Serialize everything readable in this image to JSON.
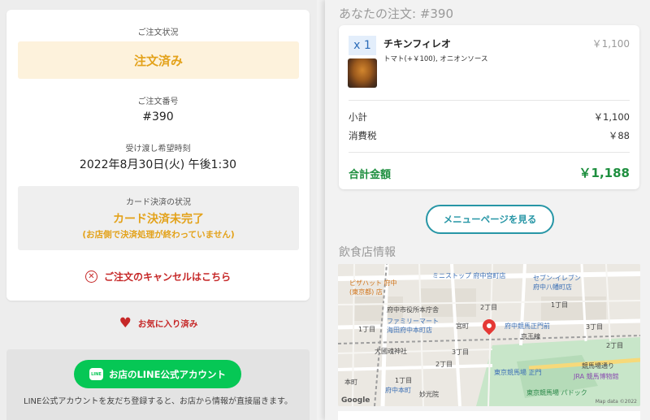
{
  "status_card": {
    "order_status_label": "ご注文状況",
    "order_status_value": "注文済み",
    "order_number_label": "ご注文番号",
    "order_number_value": "#390",
    "pickup_label": "受け渡し希望時刻",
    "pickup_value": "2022年8月30日(火) 午後1:30",
    "payment_label": "カード決済の状況",
    "payment_status": "カード決済未完了",
    "payment_note": "(お店側で決済処理が終わっていません)",
    "cancel_link": "ご注文のキャンセルはこちら"
  },
  "favorite": {
    "label": "お気に入り済み"
  },
  "line_card": {
    "button_label": "お店のLINE公式アカウント",
    "logo_text": "LINE",
    "note": "LINE公式アカウントを友だち登録すると、お店から情報が直接届きます。"
  },
  "order": {
    "title": "あなたの注文: #390",
    "item": {
      "quantity": "x 1",
      "name": "チキンフィレオ",
      "options": "トマト(+￥100), オニオンソース",
      "price": "￥1,100"
    },
    "subtotal_label": "小計",
    "subtotal_value": "￥1,100",
    "tax_label": "消費税",
    "tax_value": "￥88",
    "total_label": "合計金額",
    "total_value": "￥1,188"
  },
  "menu_button": "メニューページを見る",
  "restaurant_title": "飲食店情報",
  "map": {
    "labels": {
      "pizza": "ピザハット 府中\n(東京都) 店",
      "ministop": "ミニストップ 府中宮町店",
      "seven": "セブン-イレブン\n府中八幡町店",
      "cityhall": "府中市役所本庁舎",
      "familymart": "ファミリーマート\n海田府中本町店",
      "miyamachi": "宮町",
      "keiodori": "府中競馬正門前",
      "keioline": "京王線",
      "kunitama": "大國魂神社",
      "honmachi": "本町",
      "honmachi_st": "府中本町",
      "myokoin": "妙光院",
      "seimon": "東京競馬場 正門",
      "park": "東京競馬場 パドック",
      "jra": "JRA 競馬博物館",
      "keibajo_dori": "競馬場通り",
      "ch1": "1丁目",
      "ch2": "2丁目",
      "ch3": "3丁目",
      "ch2b": "2丁目",
      "ch1b": "1丁目",
      "ch3b": "3丁目",
      "ch1c": "1丁目",
      "ch2c": "2丁目"
    },
    "google": "Google",
    "map_data": "Map data ©2022"
  },
  "colors": {
    "accent_orange": "#e3a21a",
    "cancel_red": "#c62828",
    "line_green": "#06c755",
    "total_green": "#1e8f3f",
    "teal": "#2796a6"
  },
  "icons": {
    "cancel": "x-circle-icon",
    "favorite": "heart-icon",
    "line": "line-logo-icon",
    "pin": "map-pin-icon"
  }
}
